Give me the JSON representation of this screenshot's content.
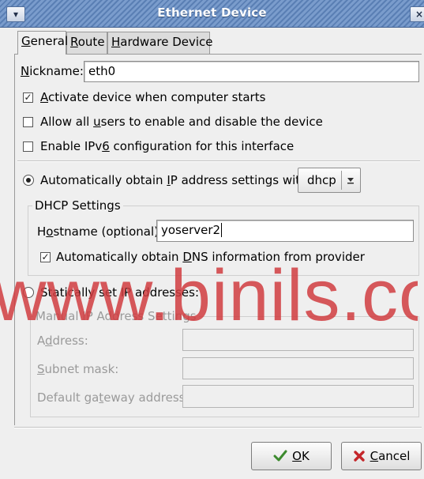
{
  "window": {
    "title": "Ethernet Device",
    "menu_icon": "▾",
    "close_icon": "×"
  },
  "tabs": [
    {
      "pre": "",
      "u": "G",
      "post": "eneral"
    },
    {
      "pre": "",
      "u": "R",
      "post": "oute"
    },
    {
      "pre": "",
      "u": "H",
      "post": "ardware Device"
    }
  ],
  "nickname": {
    "pre": "",
    "u": "N",
    "post": "ickname:",
    "value": "eth0"
  },
  "options": {
    "activate": {
      "pre": "",
      "u": "A",
      "post": "ctivate device when computer starts",
      "checked": true
    },
    "allow_users": {
      "pre": "Allow all ",
      "u": "u",
      "post": "sers to enable and disable the device",
      "checked": false
    },
    "ipv6": {
      "pre": "Enable IPv",
      "u": "6",
      "post": " configuration for this interface",
      "checked": false
    }
  },
  "auto_ip": {
    "pre": "Automatically obtain ",
    "u": "I",
    "post": "P address settings with:",
    "selected": true,
    "combo_value": "dhcp"
  },
  "dhcp": {
    "title": "DHCP Settings",
    "hostname": {
      "pre": "H",
      "u": "o",
      "post": "stname (optional):",
      "value": "yoserver2"
    },
    "dns": {
      "pre": "Automatically obtain ",
      "u": "D",
      "post": "NS information from provider",
      "checked": true
    }
  },
  "static": {
    "label": "Statically set IP addresses:",
    "group_title": "Manual IP Address Settings",
    "address": {
      "pre": "A",
      "u": "d",
      "post": "dress:"
    },
    "subnet": {
      "pre": "",
      "u": "S",
      "post": "ubnet mask:"
    },
    "gateway": {
      "pre": "Default ga",
      "u": "t",
      "post": "eway address:"
    }
  },
  "buttons": {
    "ok": {
      "pre": "",
      "u": "O",
      "post": "K"
    },
    "cancel": {
      "pre": "",
      "u": "C",
      "post": "ancel"
    }
  },
  "watermark": "www.binils.com"
}
